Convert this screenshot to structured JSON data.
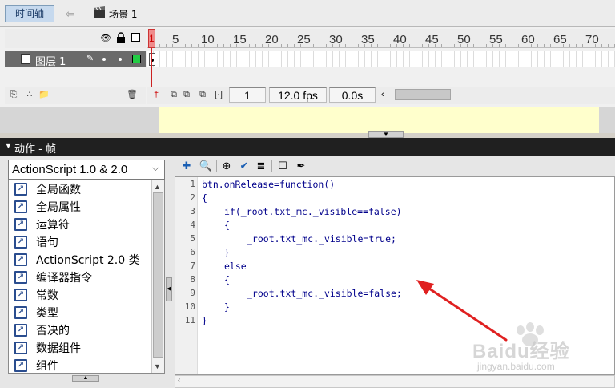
{
  "top_bar": {
    "timeline_button": "时间轴",
    "back_icon": "left-arrow-icon",
    "scene_icon": "clapperboard-icon",
    "scene_label": "场景 1"
  },
  "timeline": {
    "ruler_numbers": [
      "1",
      "5",
      "10",
      "15",
      "20",
      "25",
      "30",
      "35",
      "40",
      "45",
      "50",
      "55",
      "60",
      "65",
      "70"
    ],
    "header_icons": [
      "eye-icon",
      "lock-icon",
      "outline-icon"
    ],
    "layer": {
      "name": "图层 1",
      "color": "#22cc44"
    },
    "current_frame": "1",
    "fps": "12.0 fps",
    "elapsed": "0.0s",
    "bottom_icons": [
      "insert-layer-icon",
      "add-guide-layer-icon",
      "insert-folder-icon",
      "delete-layer-icon",
      "center-frame-icon",
      "onion-skin-icon",
      "onion-skin-outlines-icon",
      "edit-multiple-frames-icon",
      "modify-onion-markers-icon"
    ]
  },
  "stage": {
    "background": "#ffffcc"
  },
  "actions_panel": {
    "title": "动作 - 帧",
    "script_version": "ActionScript 1.0 & 2.0",
    "toolbox_items": [
      "全局函数",
      "全局属性",
      "运算符",
      "语句",
      "ActionScript 2.0 类",
      "编译器指令",
      "常数",
      "类型",
      "否决的",
      "数据组件",
      "组件"
    ],
    "toolbar_icons": [
      "add-statement-icon",
      "find-icon",
      "target-path-icon",
      "check-syntax-icon",
      "auto-format-icon",
      "code-hint-icon",
      "debug-options-icon"
    ],
    "code_lines": [
      {
        "num": "1",
        "indent": 0,
        "text": "btn.onRelease=function()"
      },
      {
        "num": "2",
        "indent": 0,
        "text": "{"
      },
      {
        "num": "3",
        "indent": 1,
        "text": "if(_root.txt_mc._visible==false)"
      },
      {
        "num": "4",
        "indent": 1,
        "text": "{"
      },
      {
        "num": "5",
        "indent": 2,
        "text": "_root.txt_mc._visible=true;"
      },
      {
        "num": "6",
        "indent": 1,
        "text": "}"
      },
      {
        "num": "7",
        "indent": 1,
        "text": "else"
      },
      {
        "num": "8",
        "indent": 1,
        "text": "{"
      },
      {
        "num": "9",
        "indent": 2,
        "text": "_root.txt_mc._visible=false;"
      },
      {
        "num": "10",
        "indent": 1,
        "text": "}"
      },
      {
        "num": "11",
        "indent": 0,
        "text": "}"
      }
    ]
  },
  "annotation": {
    "arrow_color": "#e02020"
  },
  "watermark": {
    "brand": "Baidu经验",
    "url": "jingyan.baidu.com"
  }
}
